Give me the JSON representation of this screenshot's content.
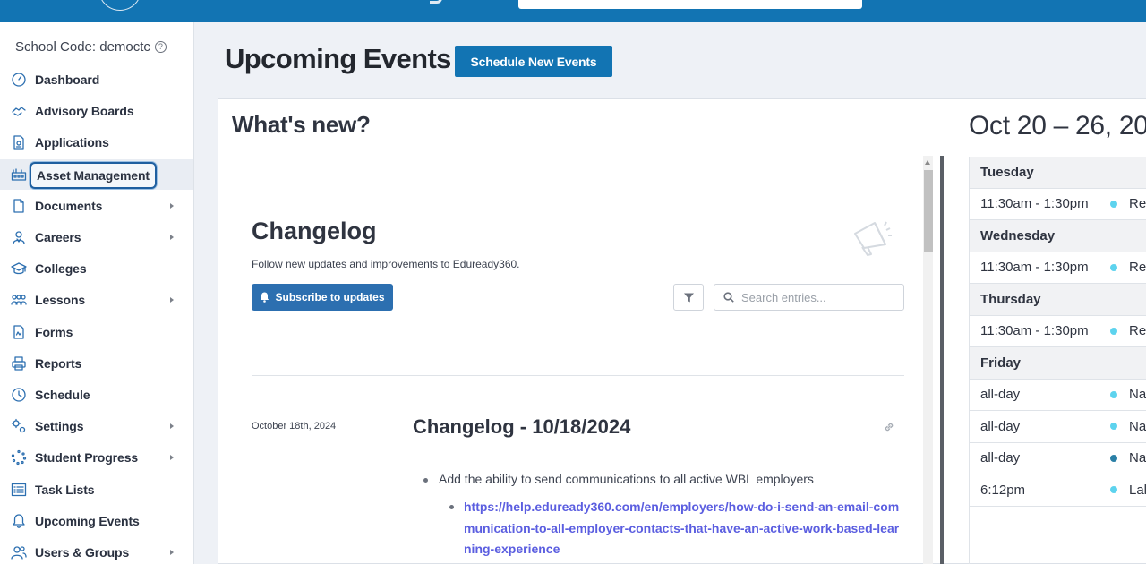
{
  "sidebar": {
    "school_code": "School Code: democtc",
    "items": [
      {
        "label": "Dashboard",
        "icon": "dashboard-icon",
        "chevron": false
      },
      {
        "label": "Advisory Boards",
        "icon": "handshake-icon",
        "chevron": false
      },
      {
        "label": "Applications",
        "icon": "document-icon",
        "chevron": false
      },
      {
        "label": "Asset Management",
        "icon": "asset-icon",
        "chevron": false,
        "active": true
      },
      {
        "label": "Documents",
        "icon": "file-icon",
        "chevron": true
      },
      {
        "label": "Careers",
        "icon": "person-icon",
        "chevron": true
      },
      {
        "label": "Colleges",
        "icon": "graduation-cap-icon",
        "chevron": false
      },
      {
        "label": "Lessons",
        "icon": "group-icon",
        "chevron": true
      },
      {
        "label": "Forms",
        "icon": "form-icon",
        "chevron": false
      },
      {
        "label": "Reports",
        "icon": "printer-icon",
        "chevron": false
      },
      {
        "label": "Schedule",
        "icon": "clock-icon",
        "chevron": false
      },
      {
        "label": "Settings",
        "icon": "gears-icon",
        "chevron": true
      },
      {
        "label": "Student Progress",
        "icon": "spinner-icon",
        "chevron": true
      },
      {
        "label": "Task Lists",
        "icon": "list-icon",
        "chevron": false
      },
      {
        "label": "Upcoming Events",
        "icon": "bell-icon",
        "chevron": false
      },
      {
        "label": "Users & Groups",
        "icon": "users-icon",
        "chevron": true
      }
    ]
  },
  "header": {
    "title": "Upcoming Events",
    "schedule_button": "Schedule New Events"
  },
  "whats_new": {
    "heading": "What's new?",
    "changelog": {
      "title": "Changelog",
      "subtitle": "Follow new updates and improvements to Eduready360.",
      "subscribe_label": "Subscribe to updates",
      "search_placeholder": "Search entries...",
      "entry": {
        "date": "October 18th, 2024",
        "title": "Changelog - 10/18/2024",
        "bullet": "Add the ability to send communications to all active WBL employers",
        "link": "https://help.eduready360.com/en/employers/how-do-i-send-an-email-communication-to-all-employer-contacts-that-have-an-active-work-based-learning-experience"
      }
    }
  },
  "calendar": {
    "range": "Oct 20 – 26, 20",
    "rows": [
      {
        "type": "day",
        "label": "Tuesday"
      },
      {
        "type": "event",
        "time": "11:30am - 1:30pm",
        "dot": "#5dd3ee",
        "title": "Re"
      },
      {
        "type": "day",
        "label": "Wednesday"
      },
      {
        "type": "event",
        "time": "11:30am - 1:30pm",
        "dot": "#5dd3ee",
        "title": "Re"
      },
      {
        "type": "day",
        "label": "Thursday"
      },
      {
        "type": "event",
        "time": "11:30am - 1:30pm",
        "dot": "#5dd3ee",
        "title": "Re"
      },
      {
        "type": "day",
        "label": "Friday"
      },
      {
        "type": "event",
        "time": "all-day",
        "dot": "#5dd3ee",
        "title": "Na"
      },
      {
        "type": "event",
        "time": "all-day",
        "dot": "#5dd3ee",
        "title": "Na"
      },
      {
        "type": "event",
        "time": "all-day",
        "dot": "#2a7fa6",
        "title": "Na"
      },
      {
        "type": "event",
        "time": "6:12pm",
        "dot": "#5dd3ee",
        "title": "Lal"
      }
    ]
  },
  "colors": {
    "brand": "#1274b3",
    "subscribe": "#2c6fb0",
    "link": "#5b5ee0"
  }
}
